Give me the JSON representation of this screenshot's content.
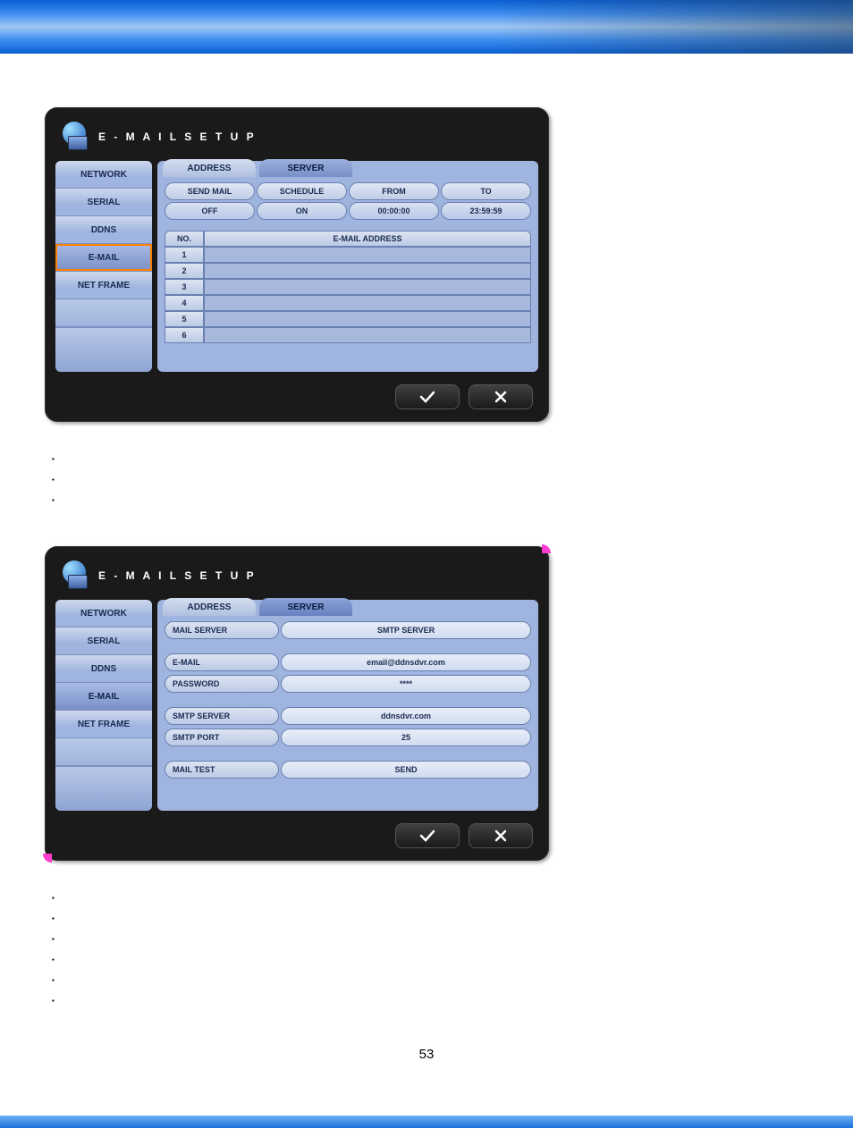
{
  "pageNumber": "53",
  "panel1": {
    "title": "E - M A I L   S E T U P",
    "sidebar": [
      "NETWORK",
      "SERIAL",
      "DDNS",
      "E-MAIL",
      "NET FRAME"
    ],
    "selectedIndex": 3,
    "tabs": {
      "address": "ADDRESS",
      "server": "SERVER",
      "active": "address"
    },
    "schedHeaders": [
      "SEND MAIL",
      "SCHEDULE",
      "FROM",
      "TO"
    ],
    "schedValues": [
      "OFF",
      "ON",
      "00:00:00",
      "23:59:59"
    ],
    "addrHeader": {
      "no": "NO.",
      "addr": "E-MAIL ADDRESS"
    },
    "addrRows": [
      "1",
      "2",
      "3",
      "4",
      "5",
      "6"
    ]
  },
  "panel2": {
    "title": "E - M A I L   S E T U P",
    "sidebar": [
      "NETWORK",
      "SERIAL",
      "DDNS",
      "E-MAIL",
      "NET FRAME"
    ],
    "selectedIndex": 3,
    "tabs": {
      "address": "ADDRESS",
      "server": "SERVER",
      "active": "server"
    },
    "rows": {
      "mailServer": {
        "label": "MAIL SERVER",
        "value": "SMTP SERVER"
      },
      "email": {
        "label": "E-MAIL",
        "value": "email@ddnsdvr.com"
      },
      "password": {
        "label": "PASSWORD",
        "value": "****"
      },
      "smtpServer": {
        "label": "SMTP SERVER",
        "value": "ddnsdvr.com"
      },
      "smtpPort": {
        "label": "SMTP PORT",
        "value": "25"
      },
      "mailTest": {
        "label": "MAIL TEST",
        "value": "SEND"
      }
    }
  },
  "bulletsA": [
    "",
    "",
    ""
  ],
  "bulletsB": [
    "",
    "",
    "",
    "",
    "",
    ""
  ]
}
